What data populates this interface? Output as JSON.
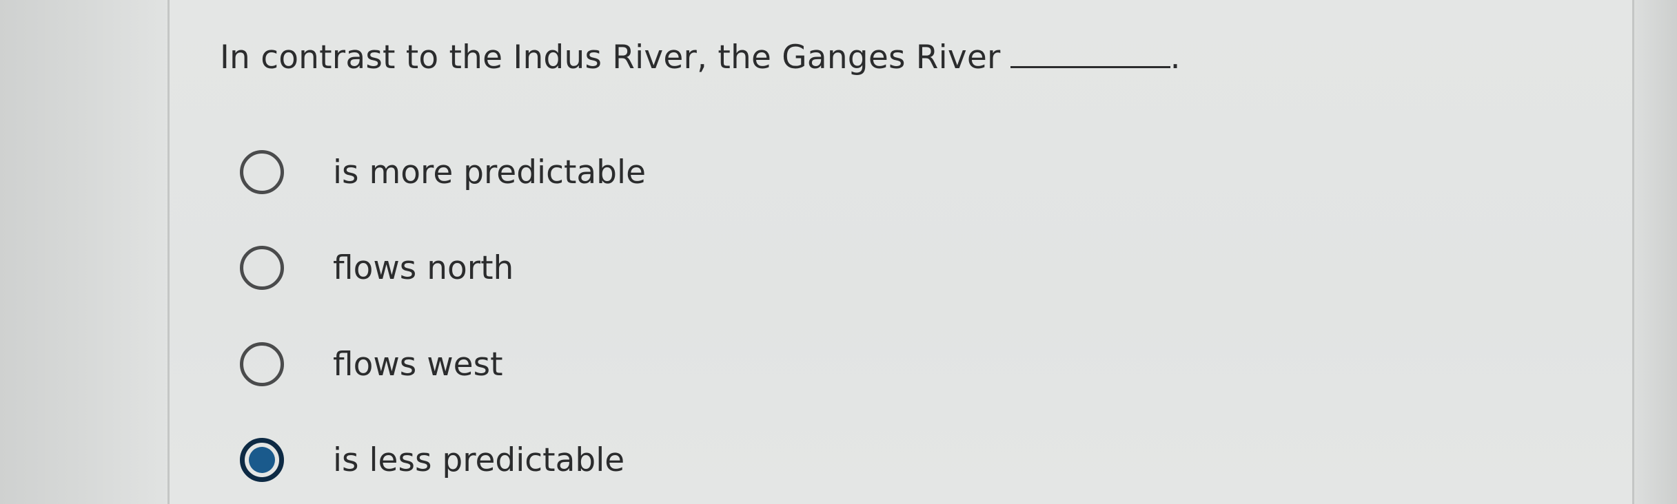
{
  "question": {
    "text": "In contrast to the Indus River, the Ganges River",
    "end_punct": "."
  },
  "options": [
    {
      "label": "is more predictable",
      "selected": false
    },
    {
      "label": "flows north",
      "selected": false
    },
    {
      "label": "flows west",
      "selected": false
    },
    {
      "label": "is less predictable",
      "selected": true
    }
  ],
  "colors": {
    "selected_fill": "#1a5a8c",
    "selected_ring": "#0d2a44",
    "text": "#2b2c2d"
  }
}
